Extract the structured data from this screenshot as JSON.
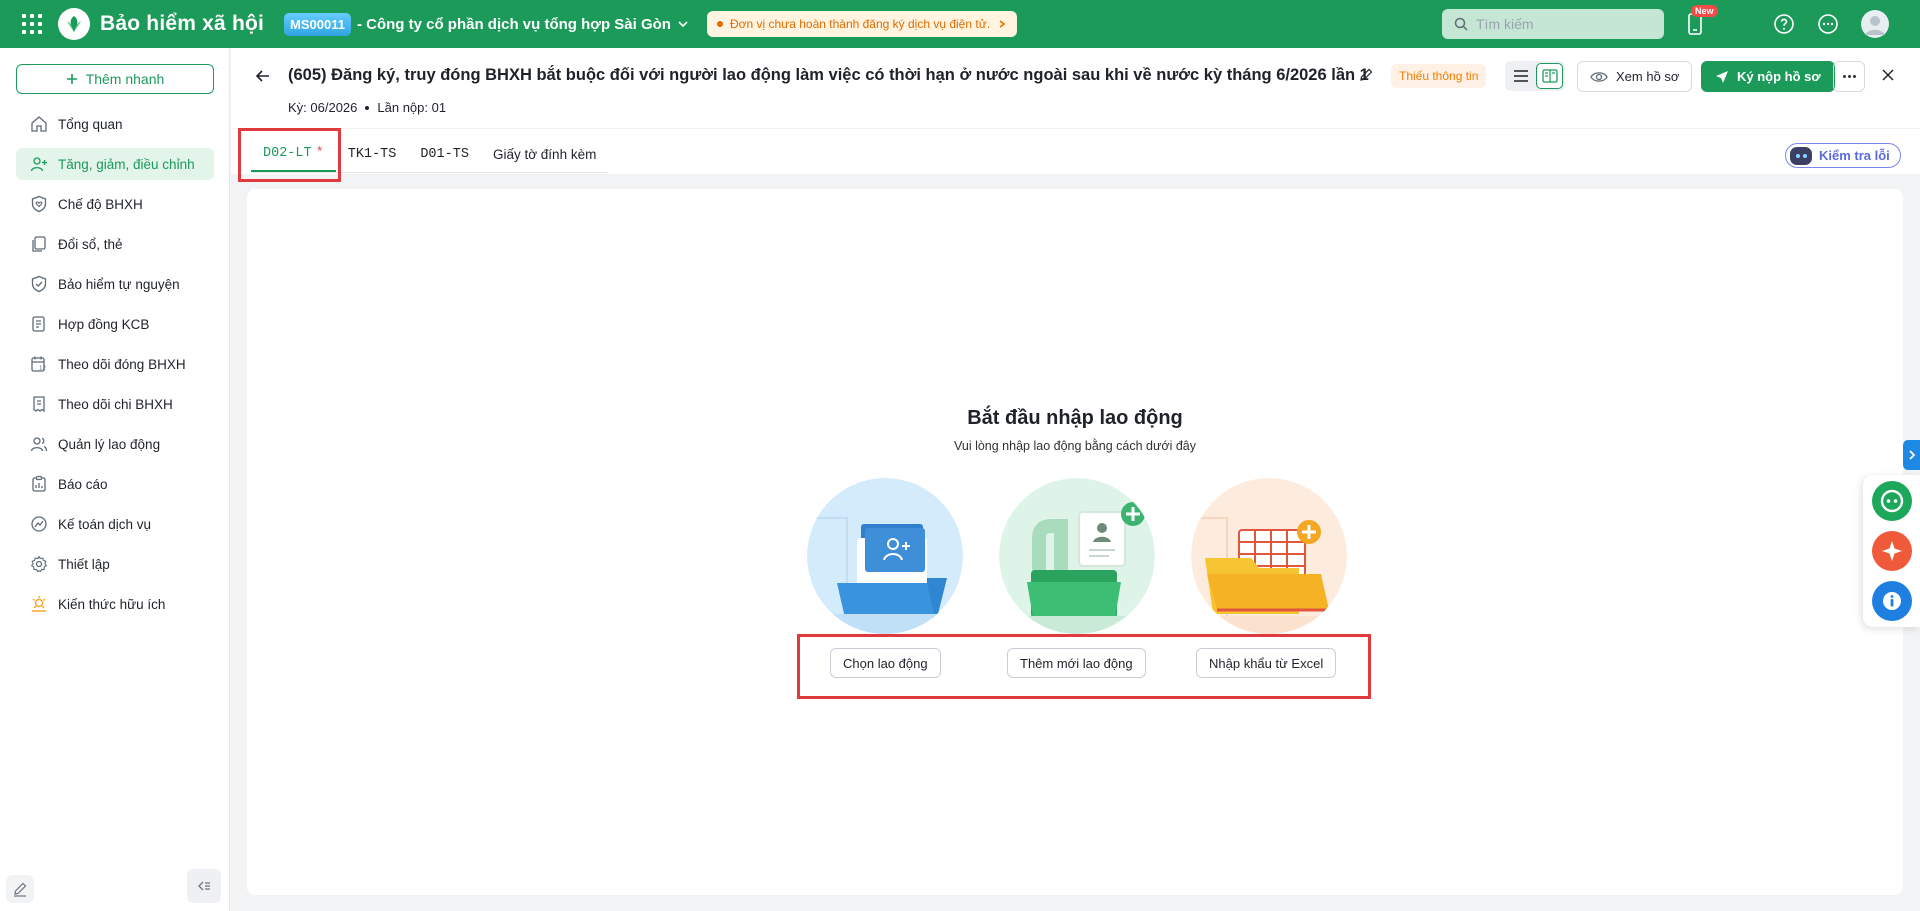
{
  "topbar": {
    "app_title": "Bảo hiểm xã hội",
    "tax_code": "MS00011",
    "company": "- Công ty cổ phần dịch vụ tổng hợp Sài Gòn",
    "warning": "Đơn vị chưa hoàn thành đăng ký dịch vụ điện tử.",
    "search_placeholder": "Tìm kiếm",
    "new_badge": "New",
    "brand_color": "#1b9a5a"
  },
  "sidebar": {
    "quick_add": "Thêm nhanh",
    "items": [
      {
        "label": "Tổng quan",
        "icon": "home-icon"
      },
      {
        "label": "Tăng, giảm, điều chỉnh",
        "icon": "user-plus-icon",
        "active": true
      },
      {
        "label": "Chế độ BHXH",
        "icon": "shield-heart-icon"
      },
      {
        "label": "Đổi sổ, thẻ",
        "icon": "document-copy-icon"
      },
      {
        "label": "Bảo hiểm tự nguyện",
        "icon": "shield-icon"
      },
      {
        "label": "Hợp đồng KCB",
        "icon": "contract-icon"
      },
      {
        "label": "Theo dõi đóng BHXH",
        "icon": "calendar-track-icon"
      },
      {
        "label": "Theo dõi chi BHXH",
        "icon": "receipt-icon"
      },
      {
        "label": "Quản lý lao động",
        "icon": "users-icon"
      },
      {
        "label": "Báo cáo",
        "icon": "report-icon"
      },
      {
        "label": "Kế toán dịch vụ",
        "icon": "accounting-icon"
      },
      {
        "label": "Thiết lập",
        "icon": "gear-icon"
      },
      {
        "label": "Kiến thức hữu ích",
        "icon": "knowledge-icon"
      }
    ]
  },
  "header": {
    "title": "(605) Đăng ký, truy đóng BHXH bắt buộc đối với người lao động làm việc có thời hạn ở nước ngoài sau khi về nước kỳ tháng 6/2026 lần 1",
    "status": "Thiếu thông tin",
    "period": "Kỳ: 06/2026",
    "submission": "Lần nộp: 01",
    "view_button": "Xem hồ sơ",
    "submit_button": "Ký nộp hồ sơ"
  },
  "tabs": [
    {
      "label": "D02-LT",
      "active": true,
      "required": "*"
    },
    {
      "label": "TK1-TS"
    },
    {
      "label": "D01-TS"
    },
    {
      "label": "Giấy tờ đính kèm"
    }
  ],
  "check_errors": "Kiểm tra lỗi",
  "empty_state": {
    "title": "Bắt đầu nhập lao động",
    "subtitle": "Vui lòng nhập lao động bằng cách dưới đây",
    "actions": [
      "Chọn lao động",
      "Thêm mới lao động",
      "Nhập khẩu từ Excel"
    ]
  }
}
